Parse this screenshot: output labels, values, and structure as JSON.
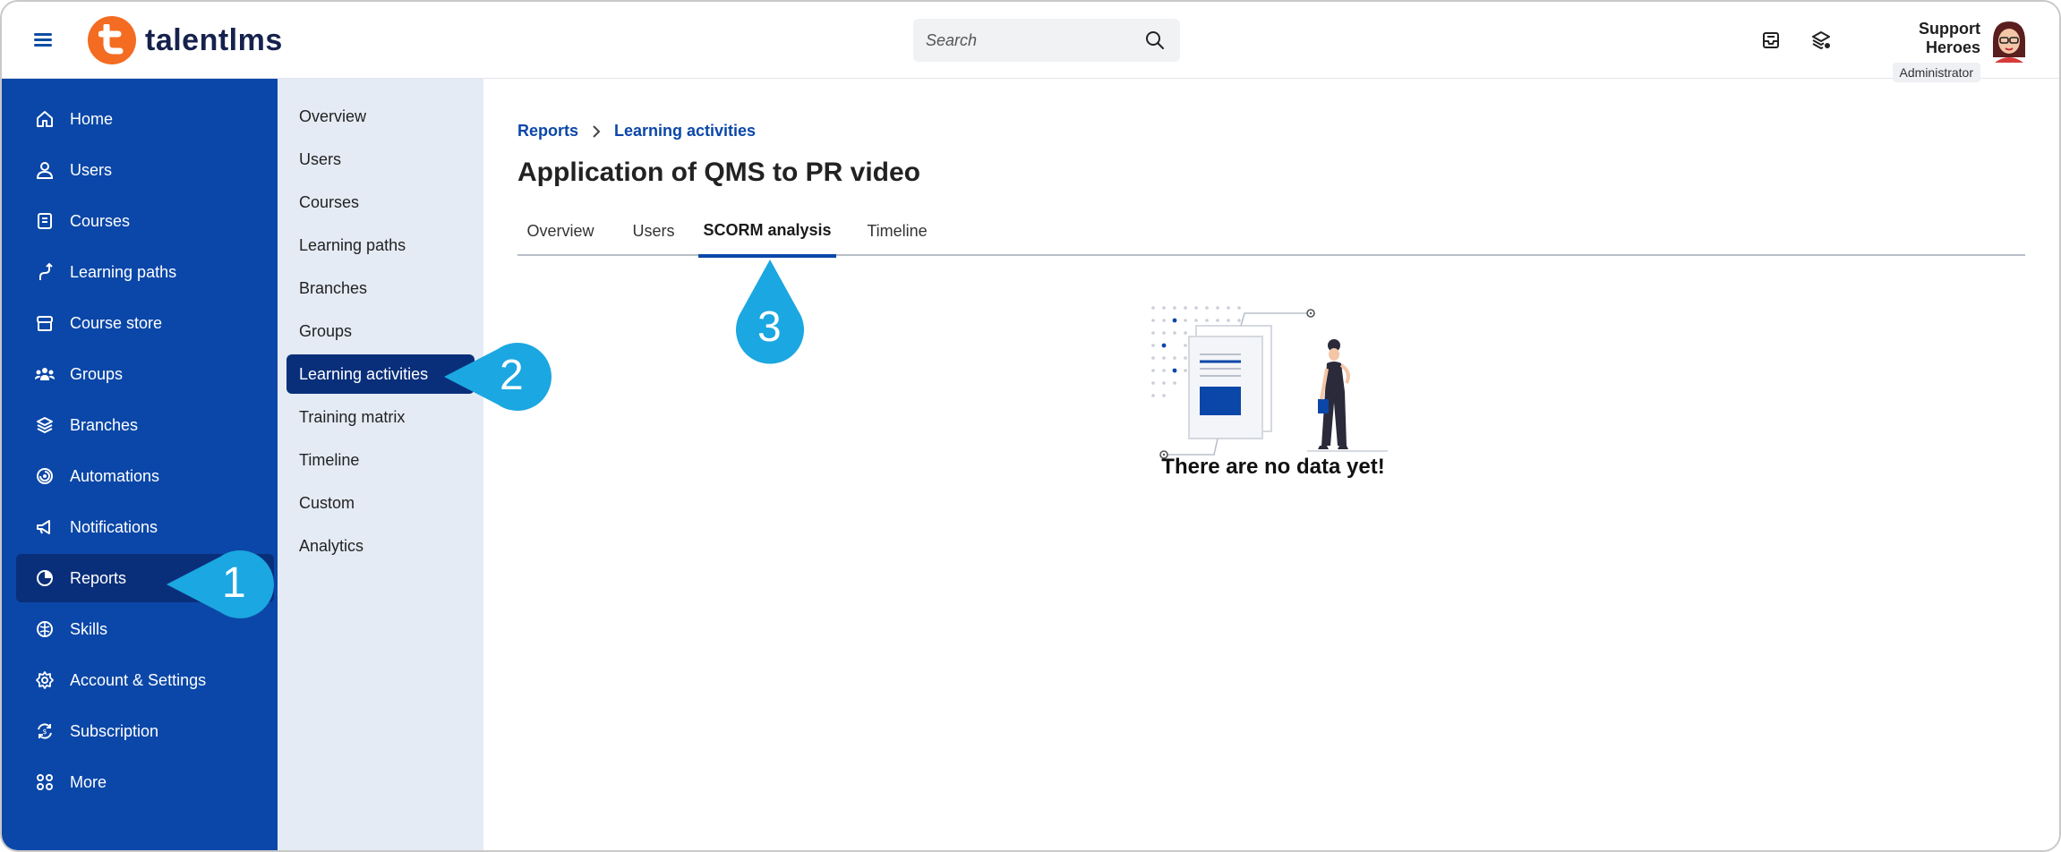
{
  "app": {
    "brand": "talentlms",
    "search_placeholder": "Search",
    "user": {
      "name": "Support Heroes",
      "role": "Administrator"
    }
  },
  "sidebar": {
    "items": [
      {
        "label": "Home",
        "icon": "home-icon"
      },
      {
        "label": "Users",
        "icon": "user-icon"
      },
      {
        "label": "Courses",
        "icon": "book-icon"
      },
      {
        "label": "Learning paths",
        "icon": "path-icon"
      },
      {
        "label": "Course store",
        "icon": "store-icon"
      },
      {
        "label": "Groups",
        "icon": "group-icon"
      },
      {
        "label": "Branches",
        "icon": "layers-icon"
      },
      {
        "label": "Automations",
        "icon": "automation-icon"
      },
      {
        "label": "Notifications",
        "icon": "megaphone-icon"
      },
      {
        "label": "Reports",
        "icon": "pie-chart-icon",
        "active": true
      },
      {
        "label": "Skills",
        "icon": "brain-icon"
      },
      {
        "label": "Account & Settings",
        "icon": "gear-icon"
      },
      {
        "label": "Subscription",
        "icon": "subscription-icon"
      },
      {
        "label": "More",
        "icon": "grid-icon"
      }
    ]
  },
  "submenu": {
    "items": [
      "Overview",
      "Users",
      "Courses",
      "Learning paths",
      "Branches",
      "Groups",
      "Learning activities",
      "Training matrix",
      "Timeline",
      "Custom",
      "Analytics"
    ],
    "active_index": 6
  },
  "main": {
    "breadcrumb": [
      "Reports",
      "Learning activities"
    ],
    "title": "Application of QMS to PR video",
    "tabs": [
      "Overview",
      "Users",
      "SCORM analysis",
      "Timeline"
    ],
    "active_tab": 2,
    "empty_message": "There are no data yet!"
  },
  "callouts": [
    "1",
    "2",
    "3"
  ],
  "colors": {
    "sidebar": "#0b47a8",
    "active": "#0a2f7a",
    "submenu": "#e5ebf5",
    "brand_orange": "#f36c21",
    "callout": "#1ba7e1"
  }
}
